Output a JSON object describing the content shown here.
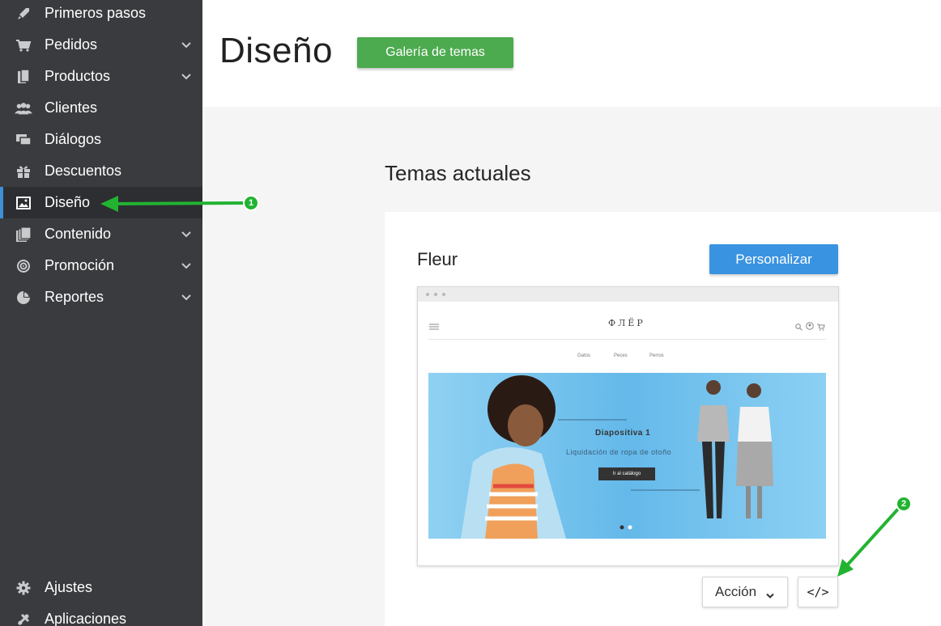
{
  "sidebar": {
    "items": [
      {
        "label": "Primeros pasos",
        "icon": "rocket-icon",
        "chevron": false
      },
      {
        "label": "Pedidos",
        "icon": "cart-icon",
        "chevron": true
      },
      {
        "label": "Productos",
        "icon": "products-icon",
        "chevron": true
      },
      {
        "label": "Clientes",
        "icon": "users-icon",
        "chevron": false
      },
      {
        "label": "Diálogos",
        "icon": "chat-icon",
        "chevron": false
      },
      {
        "label": "Descuentos",
        "icon": "gift-icon",
        "chevron": false
      },
      {
        "label": "Diseño",
        "icon": "image-icon",
        "chevron": false,
        "active": true
      },
      {
        "label": "Contenido",
        "icon": "pages-icon",
        "chevron": true
      },
      {
        "label": "Promoción",
        "icon": "target-icon",
        "chevron": true
      },
      {
        "label": "Reportes",
        "icon": "pie-chart-icon",
        "chevron": true
      }
    ],
    "bottom_items": [
      {
        "label": "Ajustes",
        "icon": "gear-icon"
      },
      {
        "label": "Aplicaciones",
        "icon": "puzzle-icon"
      }
    ]
  },
  "header": {
    "title": "Diseño",
    "gallery_button": "Galería de temas"
  },
  "main": {
    "section_title": "Temas actuales",
    "theme": {
      "name": "Fleur",
      "customize_button": "Personalizar",
      "preview": {
        "logo": "ФЛЁР",
        "menu": [
          "Gatos",
          "Peces",
          "Perros"
        ],
        "slide_title": "Diapositiva 1",
        "slide_subtitle": "Liquidación de ropa de otoño",
        "slide_button": "Ir al catálogo"
      },
      "action_button": "Acción",
      "code_button": "</>"
    }
  },
  "annotations": [
    "1",
    "2"
  ],
  "colors": {
    "sidebar_bg": "#3a3b3f",
    "active_indicator": "#3d8fd6",
    "gallery_button": "#4caa4f",
    "customize_button": "#3993e0",
    "annotation_green": "#22b331"
  }
}
